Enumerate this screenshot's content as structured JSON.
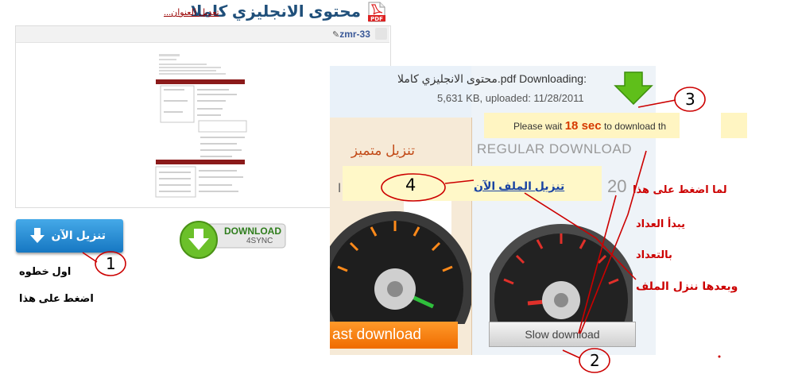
{
  "page": {
    "title": "محتوى الانجليزي كاملا",
    "edit_title": "تعديل العنوان..."
  },
  "panel": {
    "author": "zmr-33",
    "download_now": "تنزيل الآن",
    "download_4sync": {
      "line1": "DOWNLOAD",
      "line2": "4SYNC"
    },
    "first_step": "اول خطوه",
    "press_this": "اضغط على هذا"
  },
  "download_page": {
    "downloading_label": "Downloading:",
    "file_name": "محتوى الانجليزي كاملا.pdf",
    "file_info": "5,631 KB, uploaded: 11/28/2011",
    "wait_prefix": "Please wait",
    "wait_seconds": "18 sec",
    "wait_suffix": "to download th",
    "regular_download": "REGULAR DOWNLOAD",
    "premium_label": "تنزيل متميز",
    "download_file_link": "تنزيل الملف الآن",
    "counter": "20",
    "fast_download": "ast download",
    "slow_download": "Slow download",
    "premium_fragment": "ا"
  },
  "annotations": {
    "marker_1": "1",
    "marker_2": "2",
    "marker_3": "3",
    "marker_4": "4",
    "note_click": "لما اضغط على هذا",
    "note_counter_starts": "يبدأ العداد",
    "note_countdown": "بالتعداد",
    "note_then_download": "وبعدها ننزل الملف"
  },
  "colors": {
    "title": "#1f4f7a",
    "annotation_red": "#cc0000",
    "download_blue": "#1677c2",
    "fast_orange": "#ef6b00",
    "green_arrow": "#5fbf1a"
  }
}
